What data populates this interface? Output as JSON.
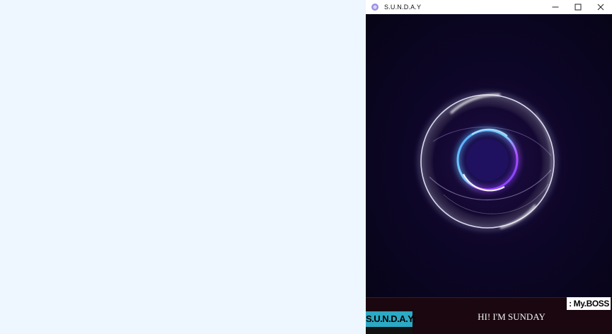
{
  "window": {
    "title": "S.U.N.D.A.Y",
    "app_icon": "orb-icon",
    "controls": {
      "minimize": "minimize-icon",
      "maximize": "maximize-icon",
      "close": "close-icon"
    }
  },
  "user_label": ": My.BOSS",
  "assistant_label": "S.U.N.D.A.Y:",
  "assistant_message": "HI! I'M SUNDAY",
  "colors": {
    "background": "#0a0618",
    "assistant_label_bg": "#2ca9c4",
    "strip_bg": "#1a0710",
    "desktop": "#eef6ff"
  }
}
